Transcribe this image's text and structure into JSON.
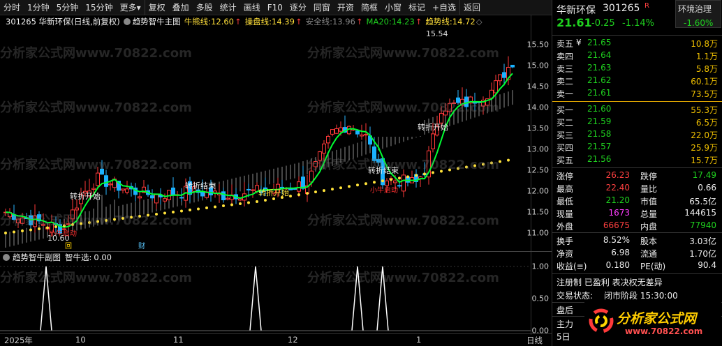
{
  "toolbar": {
    "items": [
      "分时",
      "1分钟",
      "5分钟",
      "15分钟",
      "更多",
      "复权",
      "叠加",
      "多股",
      "统计",
      "画线",
      "F10",
      "逐分",
      "同窗",
      "开资",
      "简框",
      "小窗",
      "标记",
      "+自选",
      "返回"
    ],
    "more_arrow": "▾"
  },
  "title": {
    "stock": "301265 华新环保(日线,前复权)",
    "indicator": "趋势智牛主图",
    "lines": [
      {
        "label": "牛熊线:",
        "value": "12.60",
        "arrow": "↑"
      },
      {
        "label": "操盘线:",
        "value": "14.39",
        "arrow": "↑"
      },
      {
        "label": "安全线:",
        "value": "13.96",
        "arrow": "↑"
      },
      {
        "label": "MA20:",
        "value": "14.23",
        "arrow": "↑"
      },
      {
        "label": "趋势线:",
        "value": "14.72",
        "arrow": "◇"
      }
    ]
  },
  "main_chart": {
    "ticks": [
      "15.50",
      "15.00",
      "14.50",
      "14.00",
      "13.50",
      "13.00",
      "12.50",
      "12.00",
      "11.50",
      "11.00"
    ],
    "annotations": {
      "high": "15.54",
      "low": "10.60",
      "zhuanzhe_kaishi": "转折开始",
      "zhuanzhe_jieshu": "转折结束",
      "xiaoniu_qidong": "小牛启动",
      "bottom_icon": "回",
      "cai_icon": "财"
    }
  },
  "sub_chart": {
    "title": "趋势智牛副图",
    "selector_label": "智牛选:",
    "selector_value": "0.00",
    "ticks": [
      "1.00",
      "0.50",
      "0.00"
    ]
  },
  "x_axis": {
    "labels": [
      "2025年",
      "10",
      "11",
      "12",
      "1"
    ],
    "period": "日线"
  },
  "watermark": "分析家公式网www.70822.com",
  "right_panel": {
    "name": "华新环保",
    "code": "301265",
    "r_badge": "R",
    "sector": "环境治理",
    "sector_pct": "-1.60%",
    "price": "21.61",
    "change": "-0.25",
    "pct": "-1.14%",
    "sells": [
      {
        "label": "卖五",
        "mark": "¥",
        "price": "21.65",
        "vol": "10.8万"
      },
      {
        "label": "卖四",
        "mark": "",
        "price": "21.64",
        "vol": "1.1万"
      },
      {
        "label": "卖三",
        "mark": "",
        "price": "21.63",
        "vol": "5.8万"
      },
      {
        "label": "卖二",
        "mark": "",
        "price": "21.62",
        "vol": "60.1万"
      },
      {
        "label": "卖一",
        "mark": "",
        "price": "21.61",
        "vol": "73.5万"
      }
    ],
    "buys": [
      {
        "label": "买一",
        "price": "21.60",
        "vol": "55.3万"
      },
      {
        "label": "买二",
        "price": "21.59",
        "vol": "6.5万"
      },
      {
        "label": "买三",
        "price": "21.58",
        "vol": "22.0万"
      },
      {
        "label": "买四",
        "price": "21.57",
        "vol": "25.9万"
      },
      {
        "label": "买五",
        "price": "21.56",
        "vol": "15.7万"
      }
    ],
    "stats": [
      {
        "k1": "涨停",
        "v1": "26.23",
        "k2": "跌停",
        "v2": "17.49"
      },
      {
        "k1": "最高",
        "v1": "22.40",
        "k2": "量比",
        "v2": "0.66"
      },
      {
        "k1": "最低",
        "v1": "21.20",
        "k2": "市值",
        "v2": "65.5亿"
      },
      {
        "k1": "现量",
        "v1": "1673",
        "k2": "总量",
        "v2": "144615"
      },
      {
        "k1": "外盘",
        "v1": "66675",
        "k2": "内盘",
        "v2": "77940"
      }
    ],
    "stats2": [
      {
        "k1": "换手",
        "v1": "8.52%",
        "k2": "股本",
        "v2": "3.03亿"
      },
      {
        "k1": "净资",
        "v1": "6.98",
        "k2": "流通",
        "v2": "1.70亿"
      },
      {
        "k1": "收益(≡)",
        "v1": "0.180",
        "k2": "PE(动)",
        "v2": "90.4"
      }
    ],
    "notes": [
      "注册制 已盈利 表决权无差异"
    ],
    "status_label": "交易状态:",
    "status_value": "闭市阶段 15:30:00",
    "bottom_rows": [
      "盘后",
      "主力",
      "5日"
    ],
    "logo_text": "分析家公式网",
    "logo_url": "www.70822.com"
  }
}
